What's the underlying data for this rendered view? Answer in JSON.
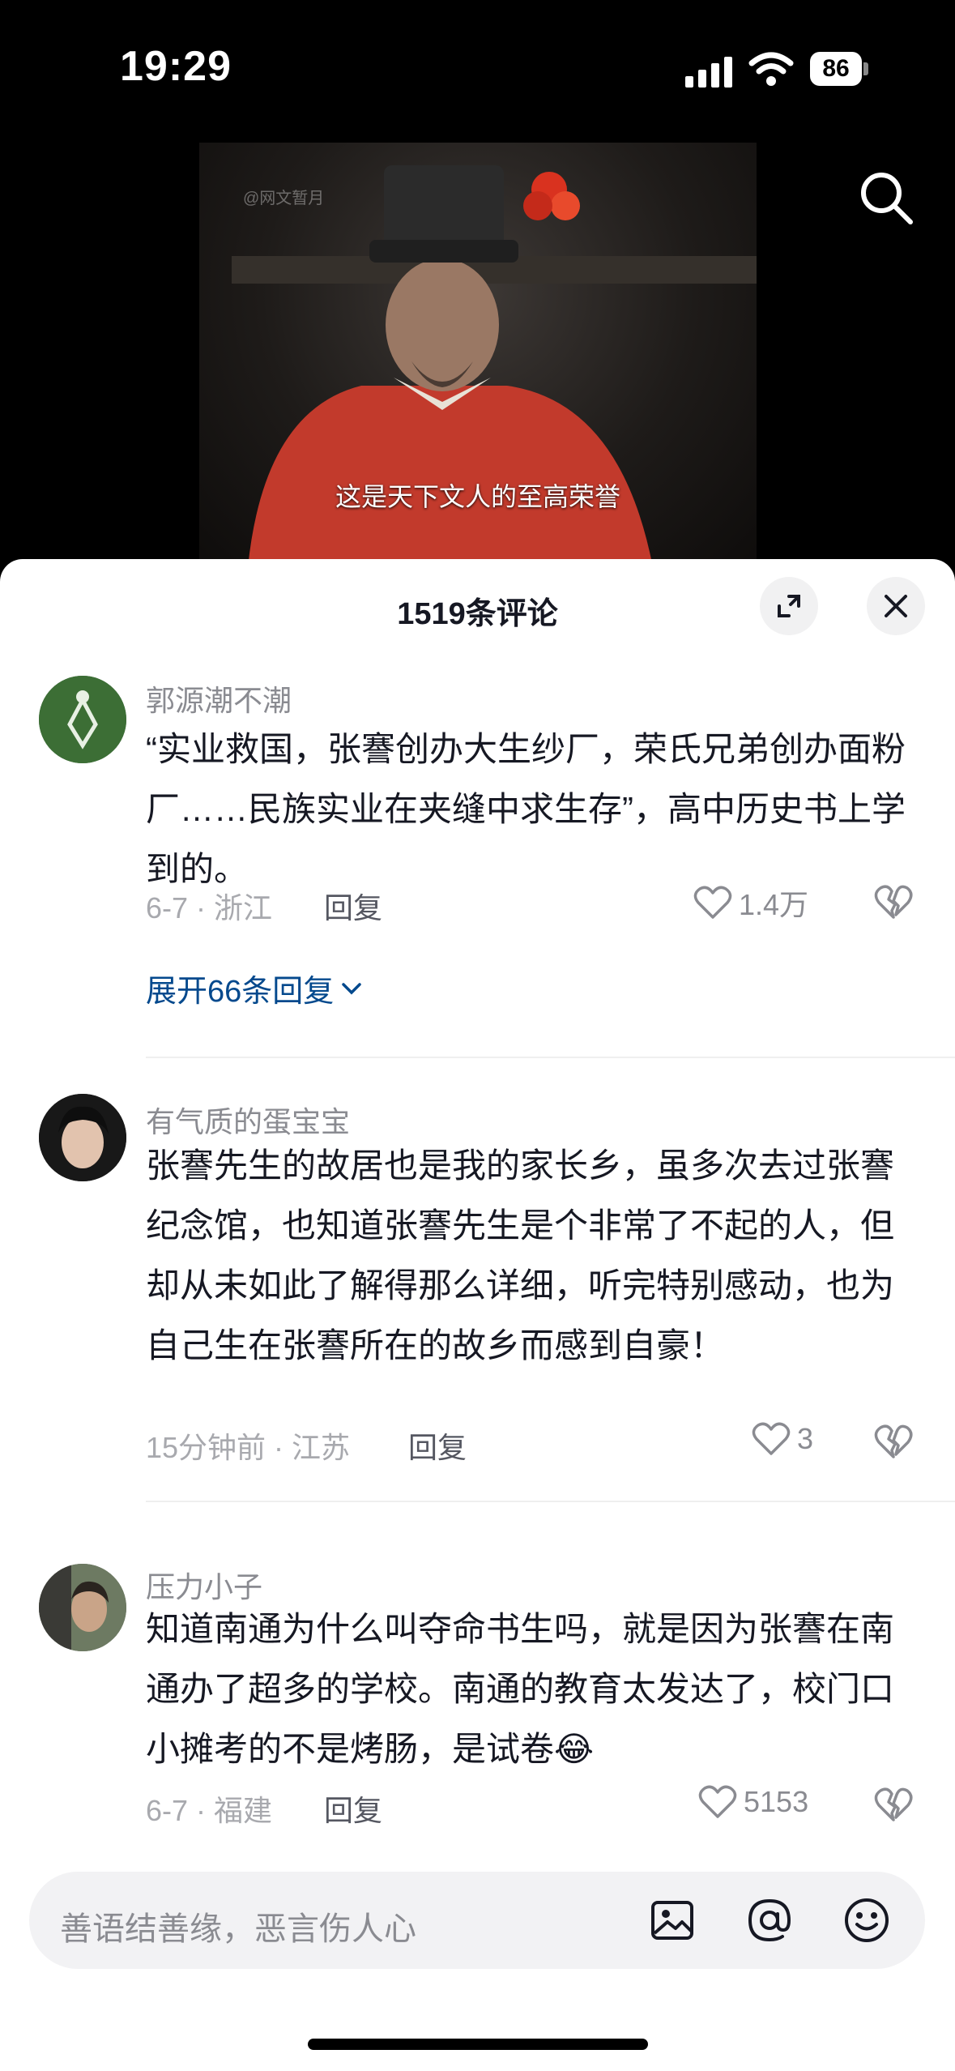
{
  "status_bar": {
    "time": "19:29",
    "battery": "86"
  },
  "video": {
    "watermark": "@网文暂月",
    "subtitle": "这是天下文人的至高荣誉",
    "search_icon": "search-icon"
  },
  "comments_panel": {
    "title": "1519条评论",
    "expand_icon": "expand-icon",
    "close_icon": "close-icon"
  },
  "comments": [
    {
      "username": "郭源潮不潮",
      "text": "“实业救国，张謇创办大生纱厂，荣氏兄弟创办面粉厂……民族实业在夹缝中求生存”，高中历史书上学到的。",
      "meta": "6-7 · 浙江",
      "reply_label": "回复",
      "likes": "1.4万",
      "expand_label": "展开66条回复"
    },
    {
      "username": "有气质的蛋宝宝",
      "text": "张謇先生的故居也是我的家长乡，虽多次去过张謇纪念馆，也知道张謇先生是个非常了不起的人，但却从未如此了解得那么详细，听完特别感动，也为自己生在张謇所在的故乡而感到自豪！",
      "meta": "15分钟前 · 江苏",
      "reply_label": "回复",
      "likes": "3"
    },
    {
      "username": "压力小子",
      "text": "知道南通为什么叫夺命书生吗，就是因为张謇在南通办了超多的学校。南通的教育太发达了，校门口小摊考的不是烤肠，是试卷",
      "emoji": "😂",
      "meta": "6-7 · 福建",
      "reply_label": "回复",
      "likes": "5153"
    }
  ],
  "input_bar": {
    "placeholder": "善语结善缘，恶言伤人心",
    "icons": [
      "image-icon",
      "at-icon",
      "emoji-icon"
    ]
  }
}
